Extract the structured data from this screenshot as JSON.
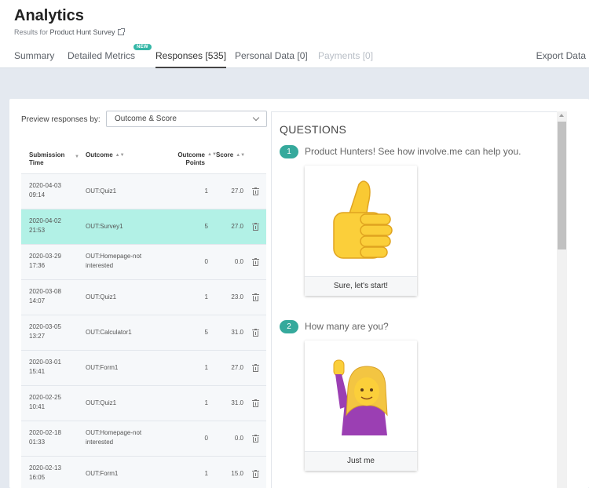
{
  "header": {
    "title": "Analytics",
    "subtitle_prefix": "Results for ",
    "survey_name": "Product Hunt Survey"
  },
  "tabs": [
    {
      "label": "Summary"
    },
    {
      "label": "Detailed Metrics",
      "badge": "NEW"
    },
    {
      "label": "Responses [535]"
    },
    {
      "label": "Personal Data [0]"
    },
    {
      "label": "Payments [0]"
    }
  ],
  "export_label": "Export Data",
  "preview": {
    "label": "Preview responses by:",
    "selected": "Outcome & Score"
  },
  "table": {
    "headers": {
      "time": "Submission Time",
      "outcome": "Outcome",
      "points": "Outcome Points",
      "score": "Score"
    },
    "rows": [
      {
        "date": "2020-04-03",
        "time": "09:14",
        "outcome": "OUT:Quiz1",
        "points": "1",
        "score": "27.0"
      },
      {
        "date": "2020-04-02",
        "time": "21:53",
        "outcome": "OUT:Survey1",
        "points": "5",
        "score": "27.0"
      },
      {
        "date": "2020-03-29",
        "time": "17:36",
        "outcome": "OUT:Homepage-not interested",
        "points": "0",
        "score": "0.0"
      },
      {
        "date": "2020-03-08",
        "time": "14:07",
        "outcome": "OUT:Quiz1",
        "points": "1",
        "score": "23.0"
      },
      {
        "date": "2020-03-05",
        "time": "13:27",
        "outcome": "OUT:Calculator1",
        "points": "5",
        "score": "31.0"
      },
      {
        "date": "2020-03-01",
        "time": "15:41",
        "outcome": "OUT:Form1",
        "points": "1",
        "score": "27.0"
      },
      {
        "date": "2020-02-25",
        "time": "10:41",
        "outcome": "OUT:Quiz1",
        "points": "1",
        "score": "31.0"
      },
      {
        "date": "2020-02-18",
        "time": "01:33",
        "outcome": "OUT:Homepage-not interested",
        "points": "0",
        "score": "0.0"
      },
      {
        "date": "2020-02-13",
        "time": "16:05",
        "outcome": "OUT:Form1",
        "points": "1",
        "score": "15.0"
      }
    ],
    "selected_row": 1
  },
  "questions": {
    "heading": "QUESTIONS",
    "items": [
      {
        "number": "1",
        "text": "Product Hunters! See how involve.me can help you.",
        "answer_emoji": "👍",
        "answer_icon": "thumbs-up-icon",
        "answer_label": "Sure, let's start!"
      },
      {
        "number": "2",
        "text": "How many are you?",
        "answer_emoji": "🙋‍♀️",
        "answer_icon": "woman-raising-hand-icon",
        "answer_label": "Just me"
      }
    ]
  },
  "colors": {
    "accent": "#35a99c",
    "selected_row": "#b2f1e6",
    "background": "#e4e9f0"
  }
}
